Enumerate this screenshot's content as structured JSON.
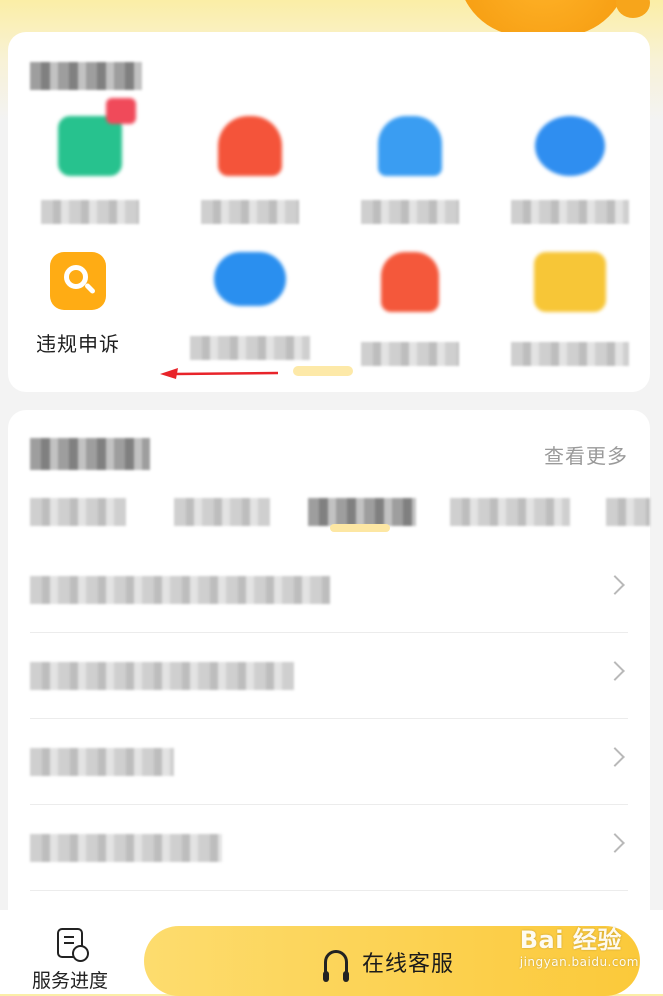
{
  "header": {
    "mascot": "mascot-sun-icon"
  },
  "services": {
    "items": [
      {
        "icon": "green-square-icon",
        "color": "#27c28e"
      },
      {
        "icon": "red-shape-icon",
        "color": "#f4543a"
      },
      {
        "icon": "blue-shape-icon",
        "color": "#3a9df2"
      },
      {
        "icon": "blue-circle-icon",
        "color": "#2f8ef0"
      },
      {
        "icon": "search-doc-icon",
        "color": "#ffac14",
        "label": "违规申诉"
      },
      {
        "icon": "blue-cloud-icon",
        "color": "#2a8fef"
      },
      {
        "icon": "red-figure-icon",
        "color": "#f4583b"
      },
      {
        "icon": "yellow-folder-icon",
        "color": "#f7c637"
      }
    ]
  },
  "annotation": {
    "arrow_color": "#e8242a"
  },
  "news": {
    "more_label": "查看更多"
  },
  "footer": {
    "progress_label": "服务进度",
    "progress_icon": "document-clock-icon",
    "service_label": "在线客服",
    "service_icon": "headset-icon",
    "accent": "#fbd14d"
  },
  "watermark": {
    "brand": "Bai 经验",
    "url": "jingyan.baidu.com"
  }
}
